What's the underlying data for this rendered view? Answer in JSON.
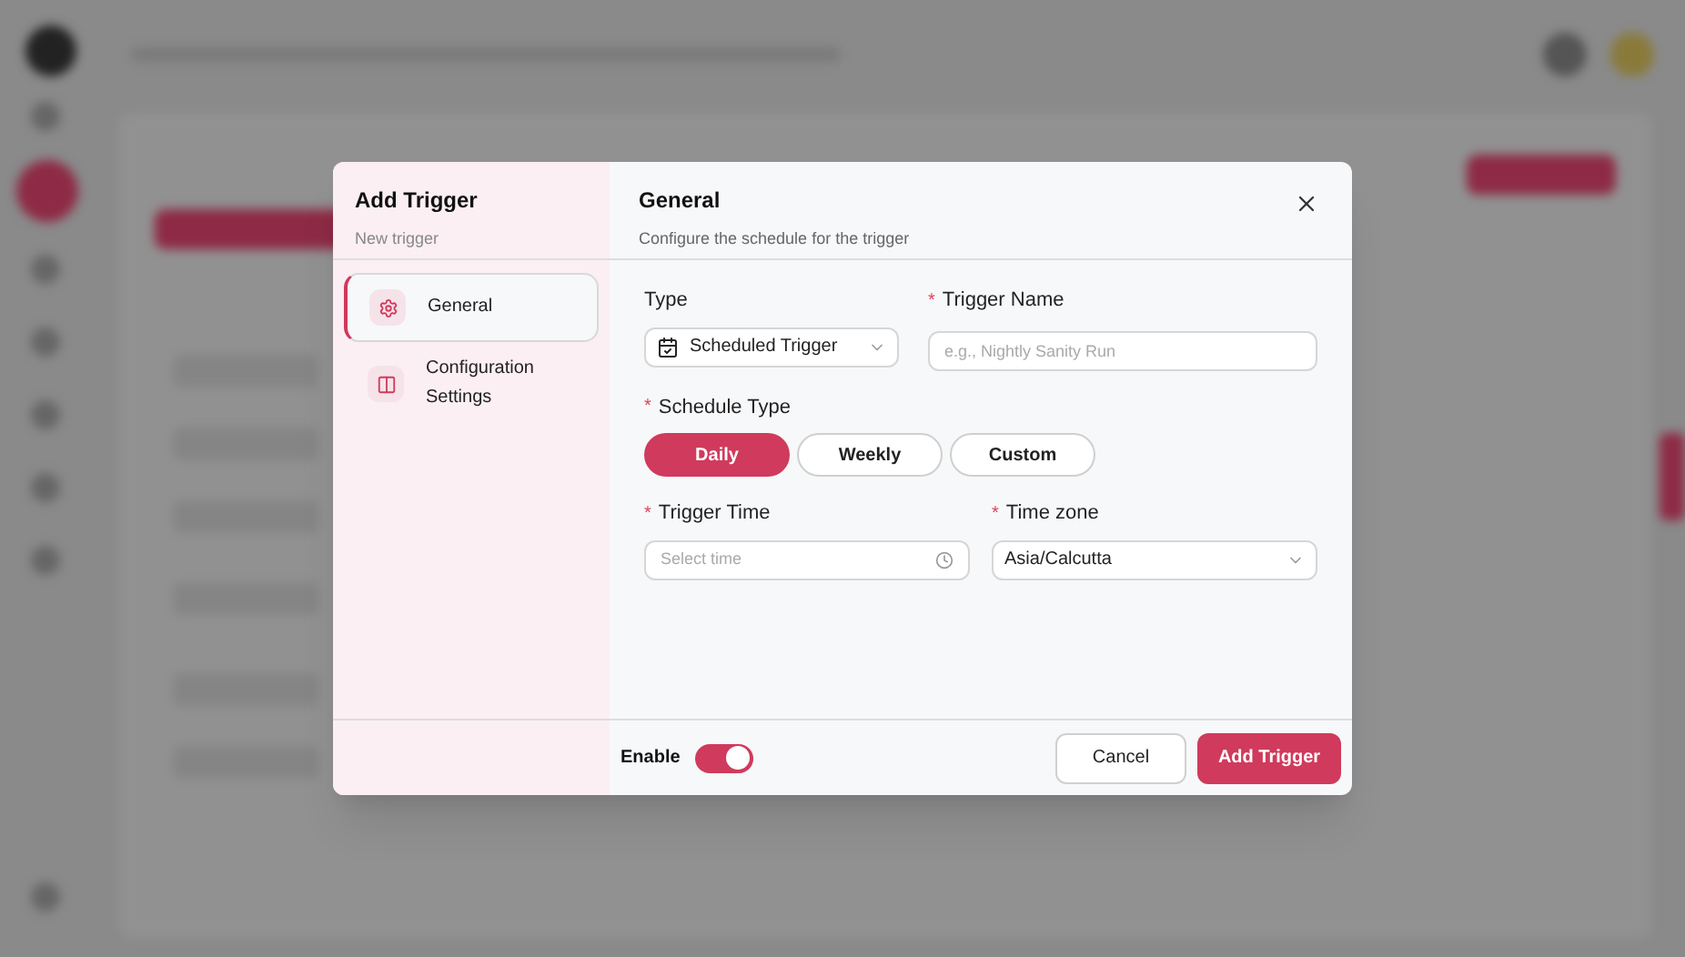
{
  "dialog": {
    "title": "Add Trigger",
    "subtitle": "New trigger"
  },
  "steps": [
    {
      "label": "General",
      "selected": true,
      "kind": "gear"
    },
    {
      "label": "Configuration Settings",
      "selected": false,
      "kind": "panel"
    }
  ],
  "section": {
    "title": "General",
    "description": "Configure the schedule for the trigger"
  },
  "type_field": {
    "label": "Type",
    "value": "Scheduled Trigger"
  },
  "trigger_name": {
    "required_mark": "*",
    "label": "Trigger Name",
    "placeholder": "e.g., Nightly Sanity Run"
  },
  "schedule_type": {
    "required_mark": "*",
    "label": "Schedule Type",
    "options": [
      {
        "label": "Daily",
        "selected": true
      },
      {
        "label": "Weekly",
        "selected": false
      },
      {
        "label": "Custom",
        "selected": false
      }
    ]
  },
  "trigger_time": {
    "required_mark": "*",
    "label": "Trigger Time",
    "placeholder": "Select time"
  },
  "time_zone": {
    "required_mark": "*",
    "label": "Time zone",
    "value": "Asia/Calcutta"
  },
  "enable": {
    "label": "Enable",
    "on": true
  },
  "buttons": {
    "cancel": "Cancel",
    "submit": "Add Trigger"
  }
}
